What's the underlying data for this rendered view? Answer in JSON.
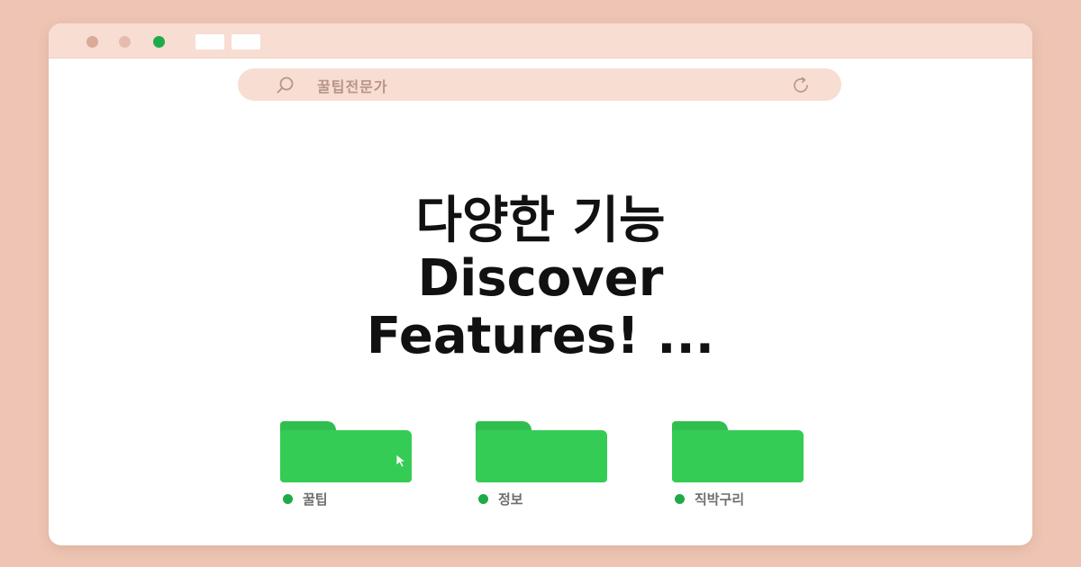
{
  "browser": {
    "search": {
      "text": "꿀팁전문가",
      "icon": "search-icon",
      "reload_icon": "reload-icon"
    },
    "window_controls": [
      "close-dot",
      "minimize-dot",
      "maximize-dot"
    ],
    "accent_color": "#1faa4a",
    "background_color": "#eec5b4",
    "chrome_color": "#f8ddd2"
  },
  "headline": {
    "line1": "다양한 기능",
    "line2": "Discover",
    "line3": "Features! ..."
  },
  "folders": [
    {
      "label": "꿀팁",
      "icon": "folder-icon",
      "color": "#35cc55"
    },
    {
      "label": "정보",
      "icon": "folder-icon",
      "color": "#35cc55"
    },
    {
      "label": "직박구리",
      "icon": "folder-icon",
      "color": "#35cc55"
    }
  ]
}
